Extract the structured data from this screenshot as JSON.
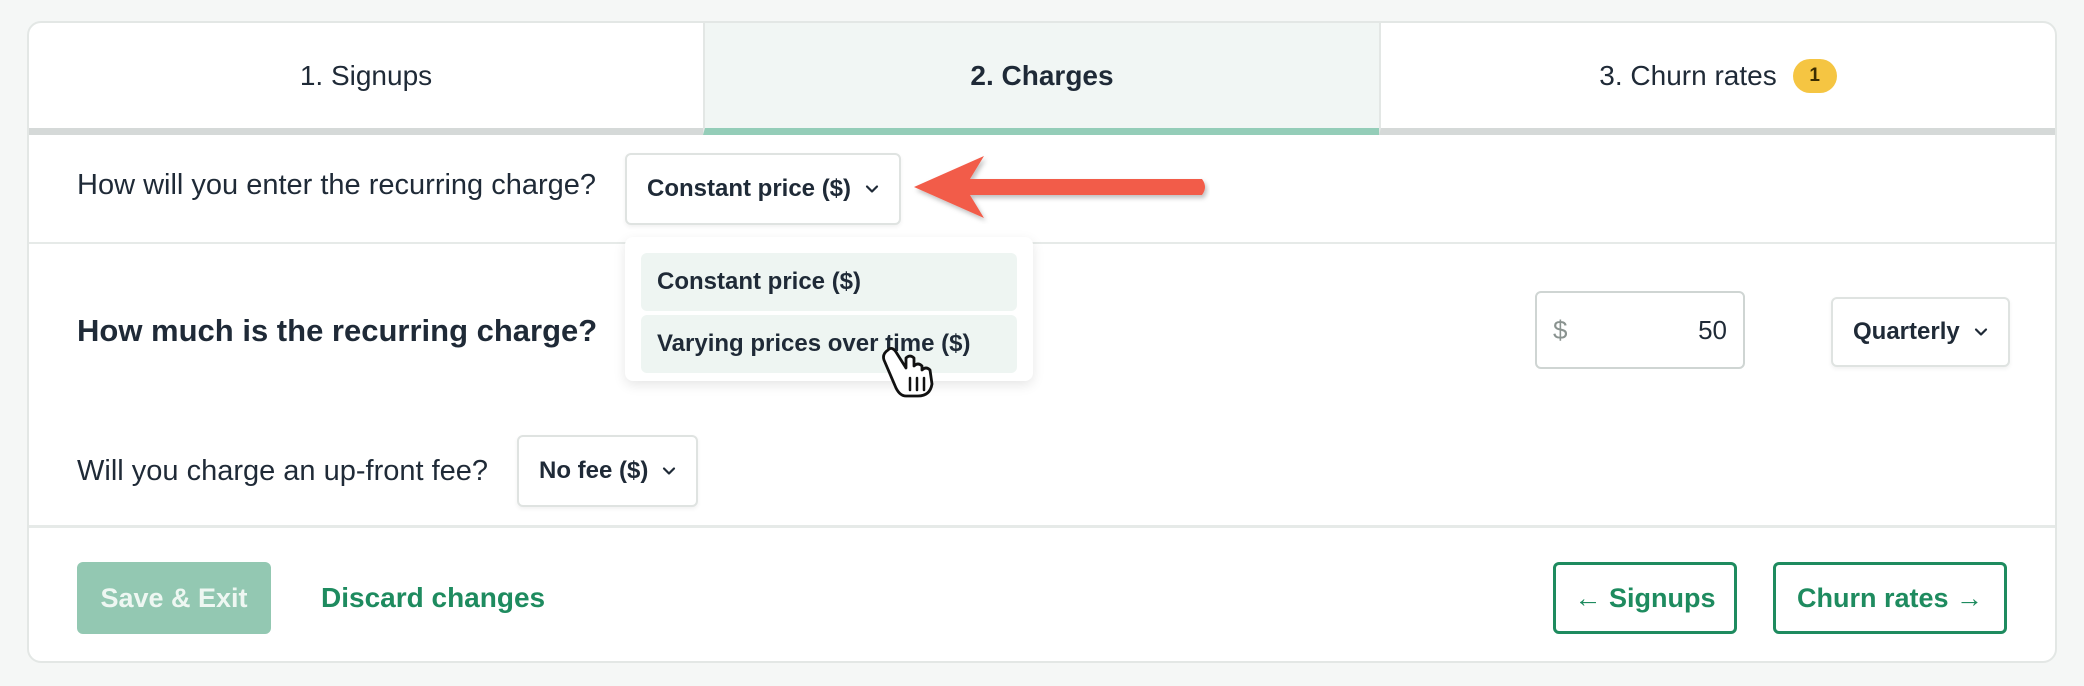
{
  "tabs": [
    {
      "label": "1. Signups"
    },
    {
      "label": "2. Charges"
    },
    {
      "label": "3. Churn rates",
      "badge": "1"
    }
  ],
  "recurring_method": {
    "question": "How will you enter the recurring charge?",
    "selected": "Constant price ($)",
    "options": [
      "Constant price ($)",
      "Varying prices over time ($)"
    ]
  },
  "recurring_amount": {
    "question": "How much is the recurring charge?",
    "currency_symbol": "$",
    "value": "50",
    "period": "Quarterly"
  },
  "upfront_fee": {
    "question": "Will you charge an up-front fee?",
    "selected": "No fee ($)"
  },
  "footer": {
    "save_label": "Save & Exit",
    "discard_label": "Discard changes",
    "prev_label": "← Signups",
    "next_label": "Churn rates →"
  },
  "colors": {
    "accent": "#1e8b5f",
    "active_tab_bar": "#94cdb8",
    "badge": "#f5c542",
    "annotation_arrow": "#f25c4a"
  }
}
